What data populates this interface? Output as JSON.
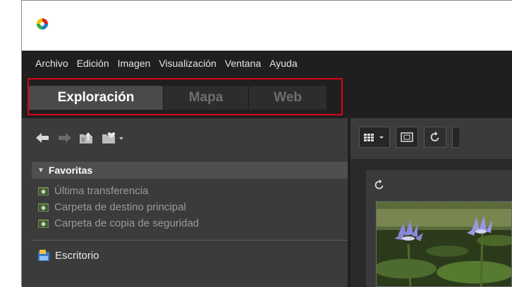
{
  "menu": [
    "Archivo",
    "Edición",
    "Imagen",
    "Visualización",
    "Ventana",
    "Ayuda"
  ],
  "tabs": [
    {
      "label": "Exploración",
      "active": true
    },
    {
      "label": "Mapa",
      "active": false
    },
    {
      "label": "Web",
      "active": false
    }
  ],
  "colors": {
    "highlight": "#e0001a",
    "dark_bg": "#1f1f1f",
    "panel_bg": "#3b3b3b"
  },
  "favorites": {
    "header": "Favoritas",
    "items": [
      "Última transferencia",
      "Carpeta de destino principal",
      "Carpeta de copia de seguridad"
    ]
  },
  "desktop_label": "Escritorio",
  "icons": [
    "app-icon",
    "back-arrow-icon",
    "forward-arrow-icon",
    "folder-up-icon",
    "favorite-folder-icon",
    "grid-view-icon",
    "fit-screen-icon",
    "rotate-icon"
  ]
}
